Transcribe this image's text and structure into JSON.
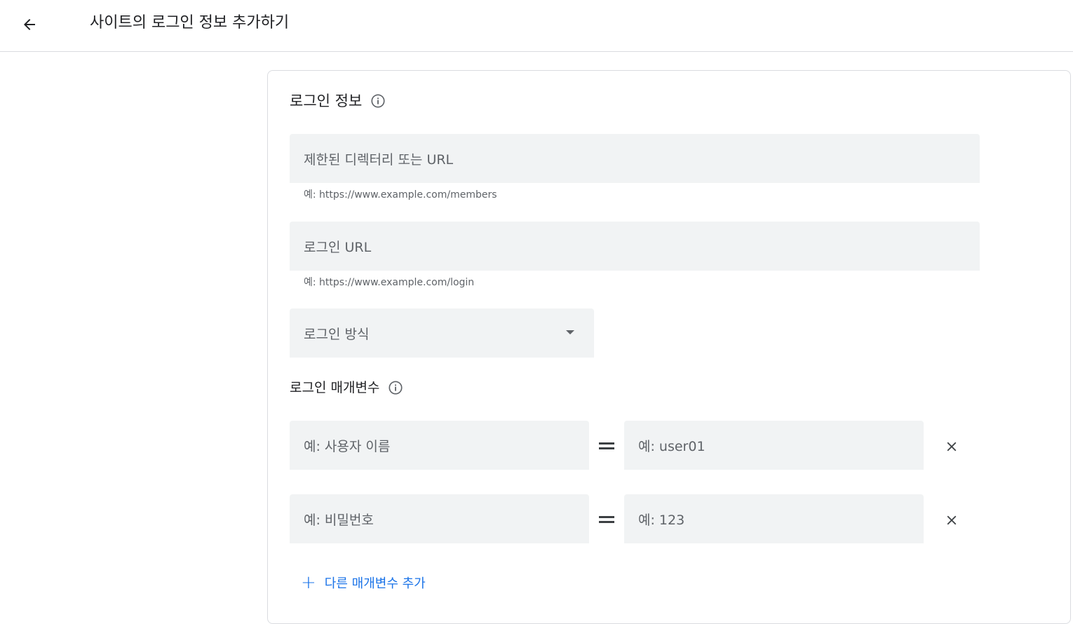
{
  "header": {
    "title": "사이트의 로그인 정보 추가하기",
    "back_icon": "arrow-back-icon"
  },
  "login_info": {
    "title": "로그인 정보",
    "restricted_url": {
      "placeholder": "제한된 디렉터리 또는 URL",
      "helper": "예: https://www.example.com/members"
    },
    "login_url": {
      "placeholder": "로그인 URL",
      "helper": "예: https://www.example.com/login"
    },
    "login_method": {
      "placeholder": "로그인 방식"
    }
  },
  "params": {
    "title": "로그인 매개변수",
    "rows": [
      {
        "name_placeholder": "예: 사용자 이름",
        "value_placeholder": "예: user01"
      },
      {
        "name_placeholder": "예: 비밀번호",
        "value_placeholder": "예: 123"
      }
    ],
    "add_label": "다른 매개변수 추가",
    "add_icon": "+"
  },
  "colors": {
    "accent": "#1a73e8",
    "field_bg": "#f1f3f4",
    "border": "#dadce0"
  }
}
